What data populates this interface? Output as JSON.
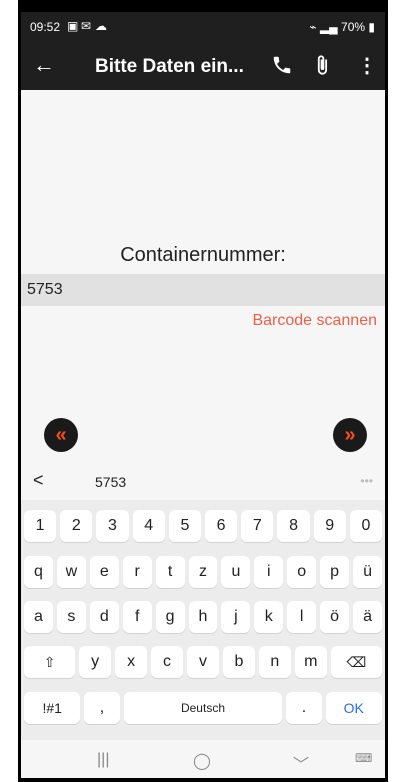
{
  "status": {
    "time": "09:52",
    "icons": [
      "image-icon",
      "mail-icon",
      "cloud-icon"
    ],
    "battery": "70%"
  },
  "appbar": {
    "title": "Bitte Daten ein...",
    "back": "back-arrow-icon",
    "phone": "phone-icon",
    "attach": "paperclip-icon",
    "more": "more-vertical-icon"
  },
  "form": {
    "label": "Containernummer:",
    "value": "5753",
    "scan": "Barcode scannen"
  },
  "nav_buttons": {
    "prev_color": "#ff4d1d",
    "next_color": "#ff4d1d"
  },
  "keyboard": {
    "suggestion": "5753",
    "row1": [
      "1",
      "2",
      "3",
      "4",
      "5",
      "6",
      "7",
      "8",
      "9",
      "0"
    ],
    "row2": [
      "q",
      "w",
      "e",
      "r",
      "t",
      "z",
      "u",
      "i",
      "o",
      "p",
      "ü"
    ],
    "row3": [
      "a",
      "s",
      "d",
      "f",
      "g",
      "h",
      "j",
      "k",
      "l",
      "ö",
      "ä"
    ],
    "row4": [
      "y",
      "x",
      "c",
      "v",
      "b",
      "n",
      "m"
    ],
    "sym": "!#1",
    "comma": ",",
    "space": "Deutsch",
    "dot": ".",
    "ok": "OK"
  }
}
